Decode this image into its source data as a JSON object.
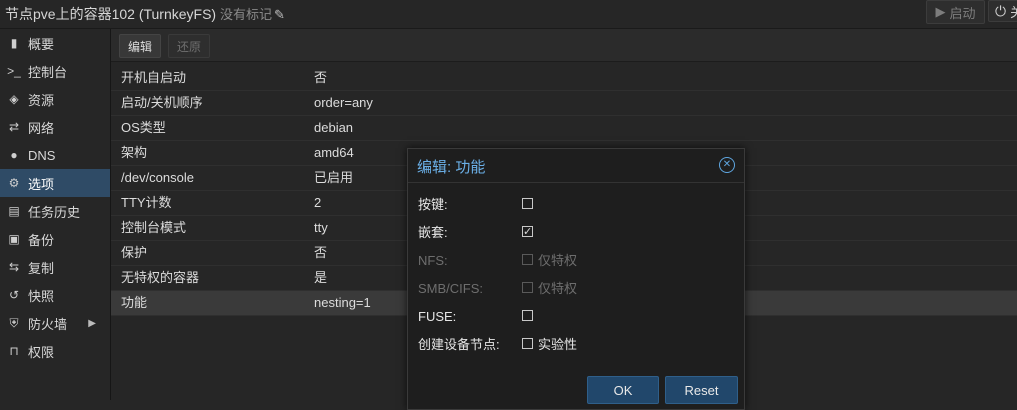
{
  "header": {
    "title": "节点pve上的容器102 (TurnkeyFS)",
    "tags": "没有标记",
    "start_label": "启动",
    "shutdown_label": "关"
  },
  "sidebar": {
    "items": [
      {
        "label": "概要",
        "icon": "book-icon",
        "glyph": "▮"
      },
      {
        "label": "控制台",
        "icon": "terminal-icon",
        "glyph": ">_"
      },
      {
        "label": "资源",
        "icon": "cube-icon",
        "glyph": "◈"
      },
      {
        "label": "网络",
        "icon": "exchange-icon",
        "glyph": "⇄"
      },
      {
        "label": "DNS",
        "icon": "globe-icon",
        "glyph": "●"
      },
      {
        "label": "选项",
        "icon": "gear-icon",
        "glyph": "⚙"
      },
      {
        "label": "任务历史",
        "icon": "list-icon",
        "glyph": "▤"
      },
      {
        "label": "备份",
        "icon": "floppy-icon",
        "glyph": "▣"
      },
      {
        "label": "复制",
        "icon": "retweet-icon",
        "glyph": "⇆"
      },
      {
        "label": "快照",
        "icon": "history-icon",
        "glyph": "↺"
      },
      {
        "label": "防火墙",
        "icon": "shield-icon",
        "glyph": "⛨"
      },
      {
        "label": "权限",
        "icon": "unlock-icon",
        "glyph": "🔓"
      }
    ],
    "selected": "选项"
  },
  "toolbar": {
    "edit_label": "编辑",
    "revert_label": "还原"
  },
  "options": {
    "rows": [
      {
        "key": "开机自启动",
        "value": "否"
      },
      {
        "key": "启动/关机顺序",
        "value": "order=any"
      },
      {
        "key": "OS类型",
        "value": "debian"
      },
      {
        "key": "架构",
        "value": "amd64"
      },
      {
        "key": "/dev/console",
        "value": "已启用"
      },
      {
        "key": "TTY计数",
        "value": "2"
      },
      {
        "key": "控制台模式",
        "value": "tty"
      },
      {
        "key": "保护",
        "value": "否"
      },
      {
        "key": "无特权的容器",
        "value": "是"
      },
      {
        "key": "功能",
        "value": "nesting=1"
      }
    ]
  },
  "dialog": {
    "title": "编辑: 功能",
    "fields": [
      {
        "label": "按键:",
        "checked": false,
        "disabled": false,
        "box_label": ""
      },
      {
        "label": "嵌套:",
        "checked": true,
        "disabled": false,
        "box_label": ""
      },
      {
        "label": "NFS:",
        "checked": false,
        "disabled": true,
        "box_label": "仅特权"
      },
      {
        "label": "SMB/CIFS:",
        "checked": false,
        "disabled": true,
        "box_label": "仅特权"
      },
      {
        "label": "FUSE:",
        "checked": false,
        "disabled": false,
        "box_label": ""
      },
      {
        "label": "创建设备节点:",
        "checked": false,
        "disabled": false,
        "box_label": "实验性"
      }
    ],
    "ok_label": "OK",
    "reset_label": "Reset"
  }
}
